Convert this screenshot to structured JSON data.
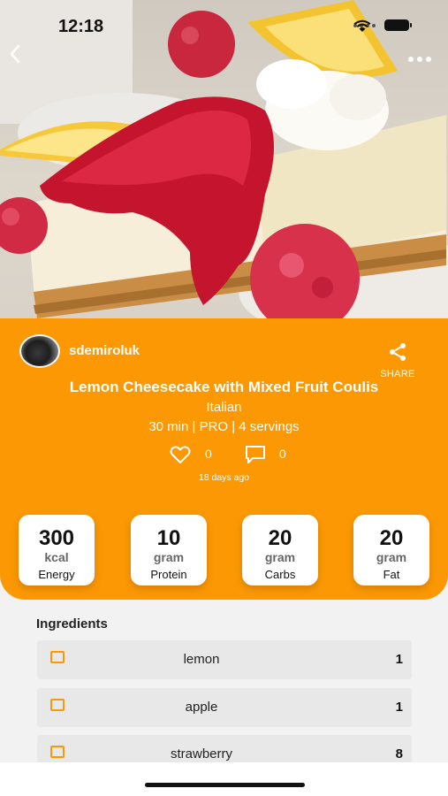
{
  "status_bar": {
    "time": "12:18"
  },
  "author": {
    "username": "sdemiroluk"
  },
  "share": {
    "label": "SHARE"
  },
  "recipe": {
    "title": "Lemon Cheesecake with Mixed Fruit Coulis",
    "cuisine": "Italian",
    "meta": "30 min | PRO | 4 servings",
    "likes": "0",
    "comments": "0",
    "posted": "18 days ago"
  },
  "nutrition": [
    {
      "value": "300",
      "unit": "kcal",
      "label": "Energy"
    },
    {
      "value": "10",
      "unit": "gram",
      "label": "Protein"
    },
    {
      "value": "20",
      "unit": "gram",
      "label": "Carbs"
    },
    {
      "value": "20",
      "unit": "gram",
      "label": "Fat"
    }
  ],
  "ingredients": {
    "title": "Ingredients",
    "items": [
      {
        "name": "lemon",
        "qty": "1"
      },
      {
        "name": "apple",
        "qty": "1"
      },
      {
        "name": "strawberry",
        "qty": "8"
      }
    ]
  },
  "colors": {
    "accent": "#fb9804",
    "card": "#ffffff",
    "row": "#e8e8e8"
  },
  "icons": [
    "back-icon",
    "more-icon",
    "share-icon",
    "heart-icon",
    "comment-icon",
    "checkbox-icon"
  ]
}
